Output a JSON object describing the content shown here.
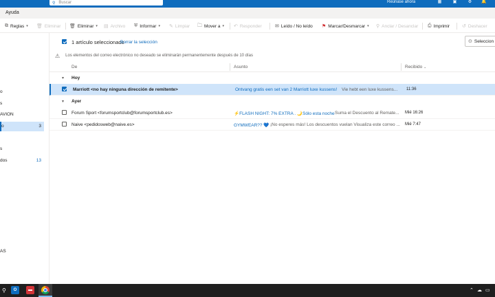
{
  "header": {
    "search_placeholder": "Buscar",
    "right_text": "Reúnase ahora"
  },
  "tabs": {
    "help": "Ayuda"
  },
  "ribbon": {
    "rules": "Reglas",
    "delete_all": "Eliminar",
    "delete": "Eliminar",
    "archive": "Archivo",
    "report": "Informar",
    "sweep": "Limpiar",
    "move_to": "Mover a",
    "reply": "Responder",
    "read_unread": "Leído / No leído",
    "flag": "Marcar/Desmarcar",
    "pin": "Anclar / Desanclar",
    "print": "Imprimir",
    "undo": "Deshacer"
  },
  "nav": {
    "items": [
      {
        "label": "o",
        "count": ""
      },
      {
        "label": "s",
        "count": ""
      },
      {
        "label": "AVION",
        "count": ""
      },
      {
        "label": "o",
        "count": "3"
      },
      {
        "label": "s",
        "count": ""
      },
      {
        "label": "dos",
        "count": "13"
      },
      {
        "label": "AS",
        "count": ""
      }
    ]
  },
  "selection": {
    "text": "1 artículo seleccionado",
    "clear_link": "Borrar la selección",
    "right_button": "Seleccion"
  },
  "info": {
    "text": "Los elementos del correo electrónico no deseado se eliminarán permanentemente después de 10 días"
  },
  "columns": {
    "from": "De",
    "subject": "Asunto",
    "received": "Recibido"
  },
  "groups": [
    {
      "label": "Hoy"
    },
    {
      "label": "Ayer"
    }
  ],
  "messages": [
    {
      "from": "Marriott <no hay ninguna dirección de remitente>",
      "subject": "Ontvang gratis een set van 2 Marriott luxe kussens!",
      "preview": "Vie hebt een luxe kussens...",
      "time": "11:36"
    },
    {
      "from": "Forum Sport <forumsportclub@forumsportclub.es>",
      "subject": "⚡FLASH NIGHT: 7% EXTRA . 🌙Sólo esta noche",
      "preview": "Suma el Descuento al Remate...",
      "time": "Mié 16:26"
    },
    {
      "from": "Naive <pedidosweb@naive.es>",
      "subject": "GYMWEAR?? 💙",
      "preview": "¡No esperes más! Los descuentos vuelan Visualiza este correo ...",
      "time": "Mié 7:47"
    }
  ],
  "colors": {
    "brand": "#0f6cbd",
    "selected_row": "#cfe4fa",
    "taskbar": "#1f1f1f"
  }
}
